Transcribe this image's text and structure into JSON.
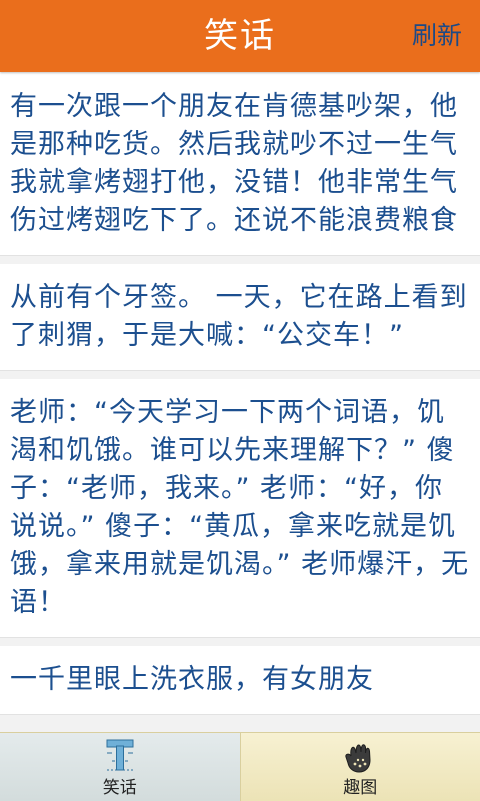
{
  "header": {
    "title": "笑话",
    "refresh_label": "刷新"
  },
  "jokes": [
    {
      "text": "有一次跟一个朋友在肯德基吵架，他是那种吃货。然后我就吵不过一生气我就拿烤翅打他，没错！他非常生气伤过烤翅吃下了。还说不能浪费粮食"
    },
    {
      "text": "从前有个牙签。 一天，它在路上看到了刺猬，于是大喊：“公交车！”"
    },
    {
      "text": "老师：“今天学习一下两个词语，饥渴和饥饿。谁可以先来理解下？” 傻子：“老师，我来。” 老师：“好，你说说。” 傻子：“黄瓜，拿来吃就是饥饿，拿来用就是饥渴。” 老师爆汗，无语！"
    },
    {
      "text": "一千里眼上洗衣服，有女朋友"
    }
  ],
  "tabbar": {
    "tabs": [
      {
        "label": "笑话",
        "icon": "letter-t-icon",
        "active": true
      },
      {
        "label": "趣图",
        "icon": "hand-icon",
        "active": false
      }
    ]
  },
  "colors": {
    "header_bg": "#ea6e1c",
    "header_title": "#ffffff",
    "refresh_text": "#1d4a86",
    "joke_text": "#1c4f8f",
    "tabbar_bg": "#ece3b6"
  }
}
